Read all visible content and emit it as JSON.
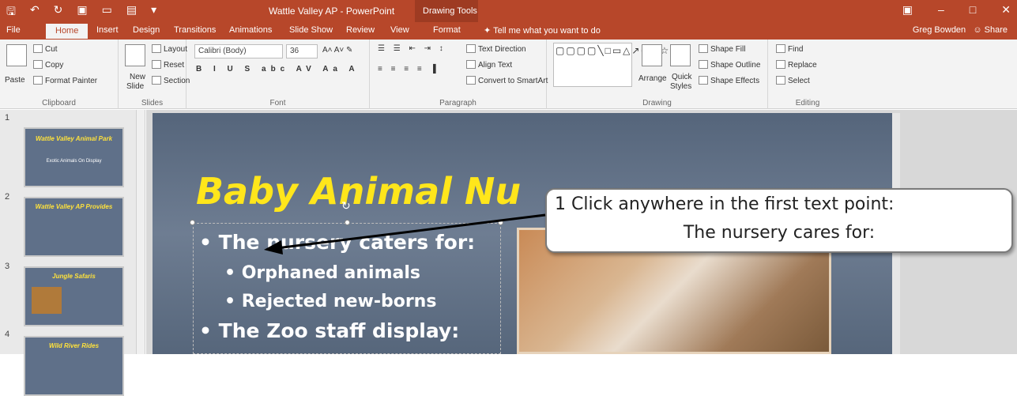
{
  "titlebar": {
    "title": "Wattle Valley AP - PowerPoint",
    "context_tab": "Drawing Tools"
  },
  "menubar": {
    "tabs": [
      "File",
      "Home",
      "Insert",
      "Design",
      "Transitions",
      "Animations",
      "Slide Show",
      "Review",
      "View",
      "Format"
    ],
    "tell_me": "Tell me what you want to do",
    "user": "Greg Bowden",
    "share": "Share"
  },
  "ribbon": {
    "clipboard": {
      "paste": "Paste",
      "cut": "Cut",
      "copy": "Copy",
      "format_painter": "Format Painter",
      "label": "Clipboard"
    },
    "slides": {
      "new_slide_1": "New",
      "new_slide_2": "Slide",
      "layout": "Layout",
      "reset": "Reset",
      "section": "Section",
      "label": "Slides"
    },
    "font": {
      "name": "Calibri (Body)",
      "size": "36",
      "label": "Font"
    },
    "paragraph": {
      "text_direction": "Text Direction",
      "align_text": "Align Text",
      "smartart": "Convert to SmartArt",
      "label": "Paragraph"
    },
    "drawing": {
      "arrange": "Arrange",
      "quick_1": "Quick",
      "quick_2": "Styles",
      "shape_fill": "Shape Fill",
      "shape_outline": "Shape Outline",
      "shape_effects": "Shape Effects",
      "label": "Drawing"
    },
    "editing": {
      "find": "Find",
      "replace": "Replace",
      "select": "Select",
      "label": "Editing"
    }
  },
  "thumbnails": [
    {
      "num": "1",
      "title": "Wattle Valley Animal Park",
      "sub": "Exotic Animals On Display"
    },
    {
      "num": "2",
      "title": "Wattle Valley AP Provides"
    },
    {
      "num": "3",
      "title": "Jungle Safaris"
    },
    {
      "num": "4",
      "title": "Wild River Rides"
    }
  ],
  "slide": {
    "title": "Baby Animal Nu",
    "bullets": [
      {
        "text": "• The nursery caters for:"
      },
      {
        "text": "• Orphaned animals"
      },
      {
        "text": "• Rejected new-borns"
      },
      {
        "text": "• The Zoo staff display:"
      }
    ]
  },
  "callout": {
    "line1": "1  Click anywhere in the first text point:",
    "line2": "The nursery cares for:"
  }
}
